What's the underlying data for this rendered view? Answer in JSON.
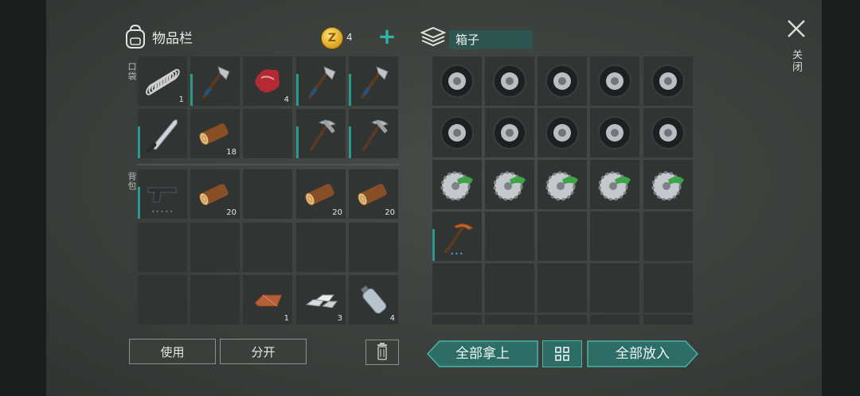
{
  "inventory": {
    "title": "物品栏",
    "coins": "4",
    "coin_symbol": "Z",
    "pocket_label": "口袋",
    "backpack_label": "背包",
    "slots": [
      {
        "item": "spring",
        "count": "1"
      },
      {
        "item": "hatchet",
        "count": "",
        "durability": true
      },
      {
        "item": "raw-meat",
        "count": "4"
      },
      {
        "item": "hatchet",
        "count": "",
        "durability": true
      },
      {
        "item": "hatchet",
        "count": "",
        "durability": true
      },
      {
        "item": "machete",
        "count": "",
        "durability": true
      },
      {
        "item": "log",
        "count": "18"
      },
      {
        "item": "",
        "count": ""
      },
      {
        "item": "pickaxe",
        "count": "",
        "durability": true
      },
      {
        "item": "pickaxe",
        "count": "",
        "durability": true
      },
      {
        "item": "pistol",
        "count": "",
        "durability": true,
        "ammo": "•••••"
      },
      {
        "item": "log",
        "count": "20"
      },
      {
        "item": "",
        "count": ""
      },
      {
        "item": "log",
        "count": "20"
      },
      {
        "item": "log",
        "count": "20"
      },
      {
        "item": "",
        "count": ""
      },
      {
        "item": "",
        "count": ""
      },
      {
        "item": "",
        "count": ""
      },
      {
        "item": "",
        "count": ""
      },
      {
        "item": "",
        "count": ""
      },
      {
        "item": "",
        "count": ""
      },
      {
        "item": "",
        "count": ""
      },
      {
        "item": "copper-ingot",
        "count": "1"
      },
      {
        "item": "iron-bars",
        "count": "3"
      },
      {
        "item": "plastic-bottle",
        "count": "4"
      }
    ],
    "use_button": "使用",
    "split_button": "分开"
  },
  "box": {
    "title": "箱子",
    "slots": [
      {
        "item": "tire"
      },
      {
        "item": "tire"
      },
      {
        "item": "tire"
      },
      {
        "item": "tire"
      },
      {
        "item": "tire"
      },
      {
        "item": "tire"
      },
      {
        "item": "tire"
      },
      {
        "item": "tire"
      },
      {
        "item": "tire"
      },
      {
        "item": "tire"
      },
      {
        "item": "saw-blade"
      },
      {
        "item": "saw-blade"
      },
      {
        "item": "saw-blade"
      },
      {
        "item": "saw-blade"
      },
      {
        "item": "saw-blade"
      },
      {
        "item": "copper-pickaxe",
        "durability": true,
        "ammo": "•••"
      },
      {
        "item": ""
      },
      {
        "item": ""
      },
      {
        "item": ""
      },
      {
        "item": ""
      },
      {
        "item": ""
      },
      {
        "item": ""
      },
      {
        "item": ""
      },
      {
        "item": ""
      },
      {
        "item": ""
      },
      {
        "item": ""
      },
      {
        "item": ""
      },
      {
        "item": ""
      },
      {
        "item": ""
      },
      {
        "item": ""
      }
    ],
    "take_all_button": "全部拿上",
    "put_all_button": "全部放入"
  },
  "close_label": "关闭",
  "colors": {
    "accent": "#2fb5a8",
    "durability": "#2b9a8e",
    "slot": "#303432"
  }
}
